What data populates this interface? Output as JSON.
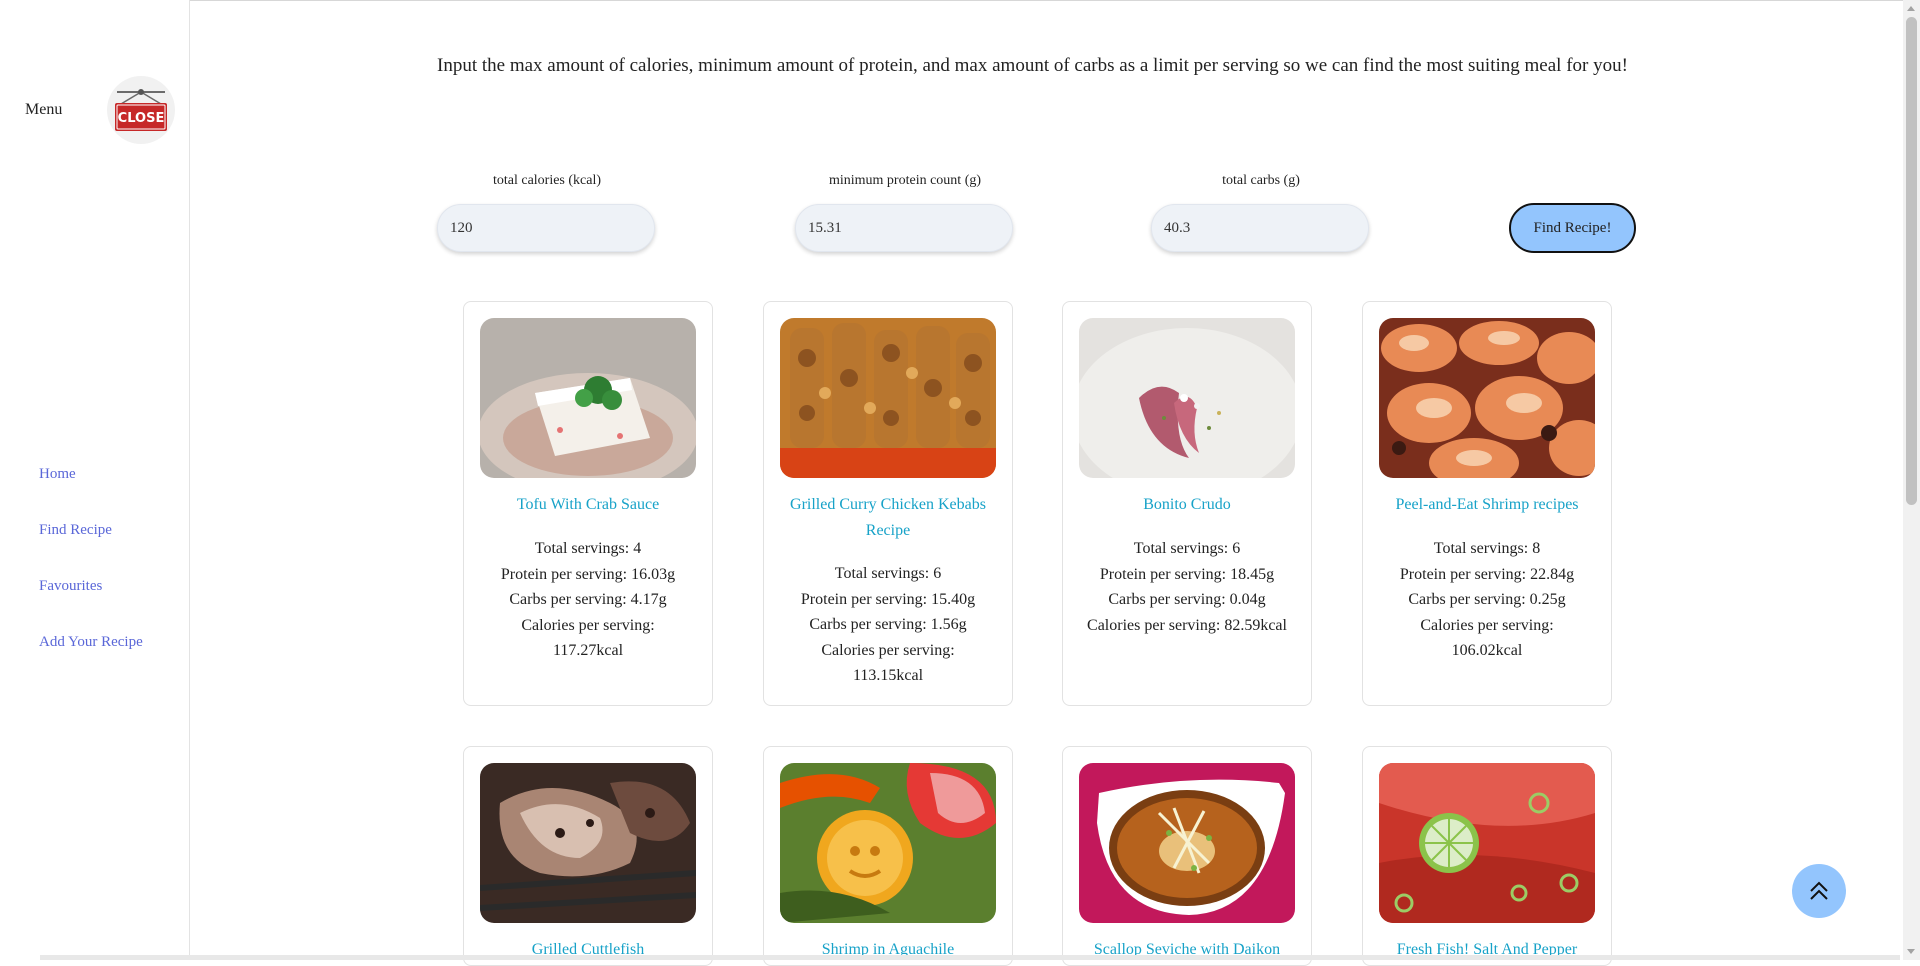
{
  "sidebar": {
    "menu_label": "Menu",
    "close_sign_text": "CLOSE",
    "nav": [
      "Home",
      "Find Recipe",
      "Favourites",
      "Add Your Recipe"
    ]
  },
  "intro_text": "Input the max amount of calories, minimum amount of protein, and max amount of carbs as a limit per serving so we can find the most suiting meal for you!",
  "form": {
    "calories_label": "total calories (kcal)",
    "calories_value": "120",
    "protein_label": "minimum protein count (g)",
    "protein_value": "15.31",
    "carbs_label": "total carbs (g)",
    "carbs_value": "40.3",
    "submit_label": "Find Recipe!"
  },
  "recipes": [
    {
      "title": "Tofu With Crab Sauce",
      "stats": [
        "Total servings: 4",
        "Protein per serving: 16.03g",
        "Carbs per serving: 4.17g",
        "Calories per serving:",
        "117.27kcal"
      ]
    },
    {
      "title": "Grilled Curry Chicken Kebabs Recipe",
      "stats": [
        "Total servings: 6",
        "Protein per serving: 15.40g",
        "Carbs per serving: 1.56g",
        "Calories per serving:",
        "113.15kcal"
      ]
    },
    {
      "title": "Bonito Crudo",
      "stats": [
        "Total servings: 6",
        "Protein per serving: 18.45g",
        "Carbs per serving: 0.04g",
        "Calories per serving: 82.59kcal"
      ]
    },
    {
      "title": "Peel-and-Eat Shrimp recipes",
      "stats": [
        "Total servings: 8",
        "Protein per serving: 22.84g",
        "Carbs per serving: 0.25g",
        "Calories per serving:",
        "106.02kcal"
      ]
    },
    {
      "title": "Grilled Cuttlefish",
      "stats": []
    },
    {
      "title": "Shrimp in Aguachile",
      "stats": []
    },
    {
      "title": "Scallop Seviche with Daikon",
      "stats": []
    },
    {
      "title": "Fresh Fish! Salt And Pepper",
      "stats": []
    }
  ]
}
